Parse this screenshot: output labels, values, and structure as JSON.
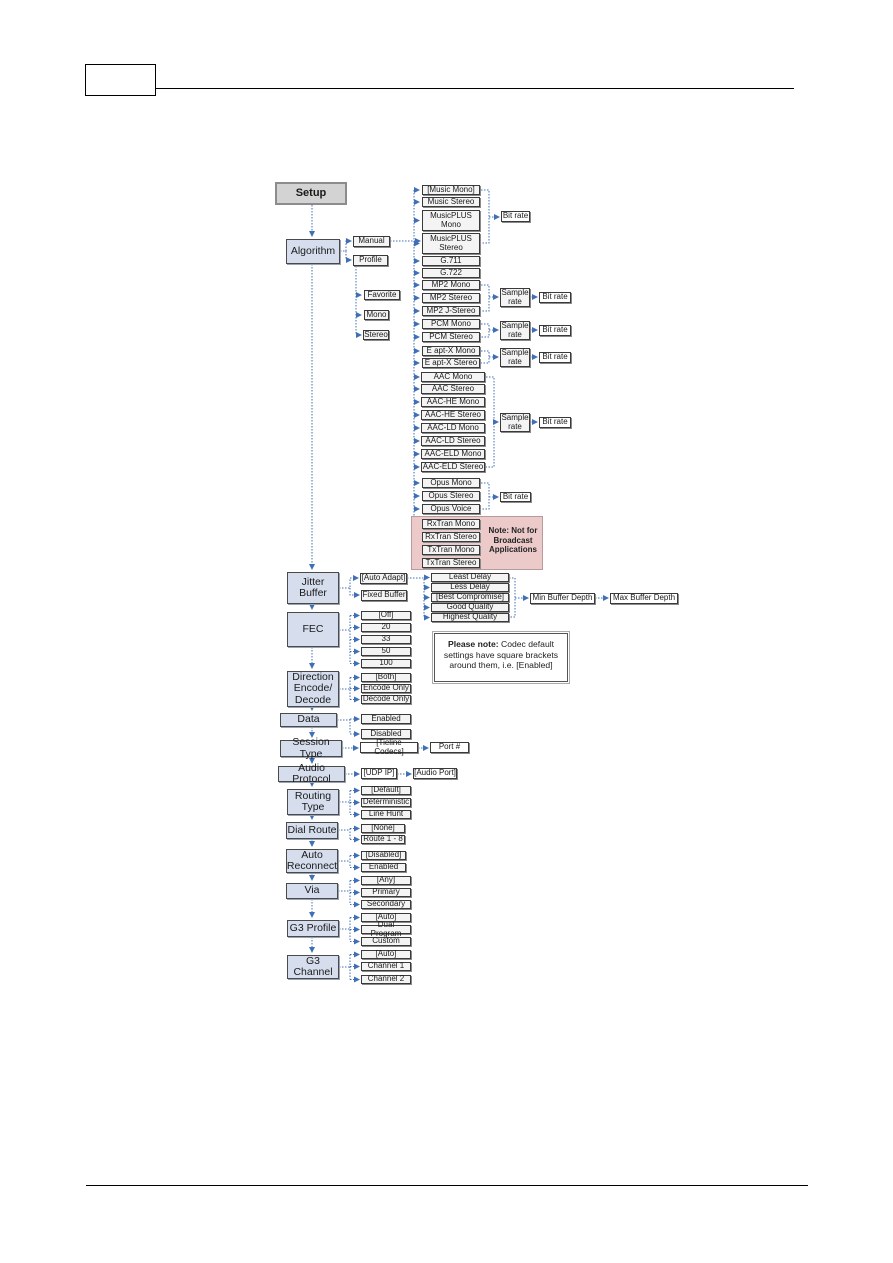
{
  "page": {
    "header_box_text": "",
    "footer_text": ""
  },
  "diagram": {
    "title": "Setup",
    "accent_color": "#3f6fb5",
    "main_box_color": "#d6deee",
    "pink_note_color": "#eccaca",
    "algorithm": {
      "label": "Algorithm",
      "modes": [
        "Manual",
        "Profile"
      ],
      "profiles": [
        "Favorite",
        "Mono",
        "Stereo"
      ],
      "codecs": [
        "[Music Mono]",
        "Music Stereo",
        "MusicPLUS Mono",
        "MusicPLUS Stereo",
        "G.711",
        "G.722",
        "MP2 Mono",
        "MP2 Stereo",
        "MP2 J-Stereo",
        "PCM Mono",
        "PCM Stereo",
        "E apt-X Mono",
        "E apt-X Stereo",
        "AAC Mono",
        "AAC Stereo",
        "AAC-HE Mono",
        "AAC-HE Stereo",
        "AAC-LD Mono",
        "AAC-LD Stereo",
        "AAC-ELD Mono",
        "AAC-ELD Stereo",
        "Opus Mono",
        "Opus Stereo",
        "Opus Voice",
        "RxTran Mono",
        "RxTran Stereo",
        "TxTran Mono",
        "TxTran Stereo"
      ],
      "bit_rate_label": "Bit rate",
      "sample_rate_label": "Sample rate",
      "rxtran_note": "Note: Not for Broadcast Applications"
    },
    "jitter_buffer": {
      "label": "Jitter Buffer",
      "modes": [
        "[Auto Adapt]",
        "Fixed Buffer"
      ],
      "auto_options": [
        "Least Delay",
        "Less Delay",
        "[Best Compromise]",
        "Good Quality",
        "Highest Quality"
      ],
      "min_label": "Min Buffer Depth",
      "max_label": "Max Buffer Depth"
    },
    "fec": {
      "label": "FEC",
      "options": [
        "[Off]",
        "20",
        "33",
        "50",
        "100"
      ]
    },
    "note": {
      "bold": "Please note:",
      "text": " Codec default settings have square brackets around them, i.e. [Enabled]"
    },
    "direction": {
      "label": "Direction Encode/ Decode",
      "options": [
        "[Both]",
        "Encode Only",
        "Decode Only"
      ]
    },
    "data": {
      "label": "Data",
      "options": [
        "Enabled",
        "Disabled"
      ]
    },
    "session_type": {
      "label": "Session Type",
      "options": [
        "[Tieline Codecs]"
      ],
      "next": "Port #"
    },
    "audio_protocol": {
      "label": "Audio Protocol",
      "options": [
        "[UDP IP]"
      ],
      "next": "[Audio Port]"
    },
    "routing_type": {
      "label": "Routing Type",
      "options": [
        "[Default]",
        "Deterministic",
        "Line Hunt"
      ]
    },
    "dial_route": {
      "label": "Dial Route",
      "options": [
        "[None]",
        "Route 1 - 8"
      ]
    },
    "auto_reconnect": {
      "label": "Auto Reconnect",
      "options": [
        "[Disabled]",
        "Enabled"
      ]
    },
    "via": {
      "label": "Via",
      "options": [
        "[Any]",
        "Primary",
        "Secondary"
      ]
    },
    "g3_profile": {
      "label": "G3 Profile",
      "options": [
        "[Auto]",
        "Dual Program",
        "Custom"
      ]
    },
    "g3_channel": {
      "label": "G3 Channel",
      "options": [
        "[Auto]",
        "Channel 1",
        "Channel 2"
      ]
    }
  }
}
